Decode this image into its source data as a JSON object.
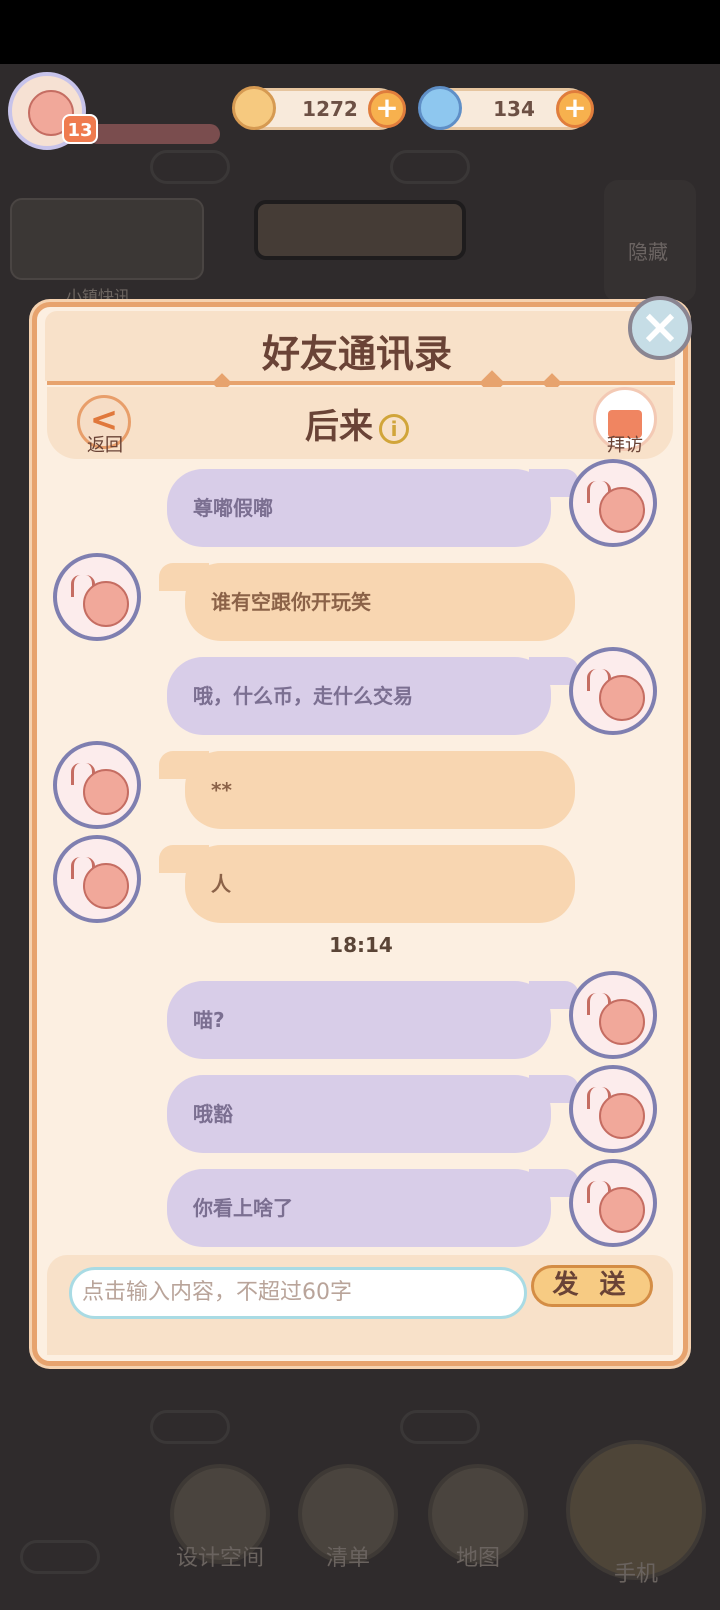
{
  "top_bar": {
    "level": "13",
    "coins": "1272",
    "gems": "134"
  },
  "scene": {
    "news_label": "小镇快讯",
    "hide_label": "隐藏"
  },
  "dialog": {
    "title": "好友通讯录",
    "back_label": "返回",
    "visit_label": "拜访",
    "friend_name": "后来",
    "messages": [
      {
        "from": "me",
        "text": "尊嘟假嘟"
      },
      {
        "from": "friend",
        "text": "谁有空跟你开玩笑"
      },
      {
        "from": "me",
        "text": "哦，什么币，走什么交易"
      },
      {
        "from": "friend",
        "text": "**"
      },
      {
        "from": "friend",
        "text": "人"
      },
      {
        "from": "me",
        "text": "喵?"
      },
      {
        "from": "me",
        "text": "哦豁"
      },
      {
        "from": "me",
        "text": "你看上啥了"
      }
    ],
    "timestamp": "18:14",
    "input_placeholder": "点击输入内容，不超过60字",
    "send_label": "发 送"
  },
  "bottom_nav": {
    "design_label": "设计空间",
    "list_label": "清单",
    "map_label": "地图",
    "phone_label": "手机"
  },
  "colors": {
    "me_bubble": "#d8cde8",
    "friend_bubble": "#f8d6b1",
    "dialog_bg": "#fcefe1",
    "accent": "#e7a36e"
  }
}
